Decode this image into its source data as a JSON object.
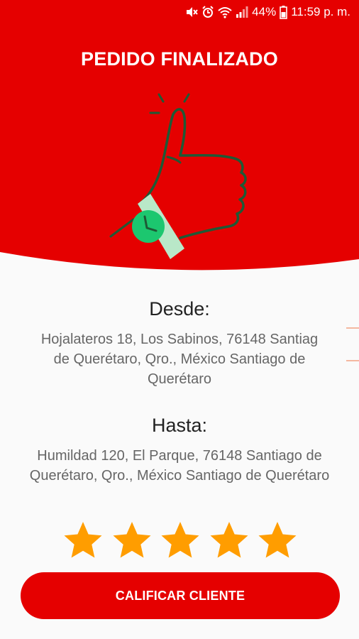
{
  "status_bar": {
    "battery": "44%",
    "time": "11:59 p. m."
  },
  "header": {
    "title": "PEDIDO FINALIZADO"
  },
  "origin": {
    "label": "Desde:",
    "address_lines": [
      "Hojalateros 18, Los Sabinos, 76148 Santiag",
      "de Querétaro, Qro., México Santiago de",
      "Querétaro"
    ]
  },
  "destination": {
    "label": "Hasta:",
    "address_lines": [
      "Humildad 120, El Parque, 76148 Santiago de",
      "Querétaro, Qro., México Santiago de Querétaro"
    ]
  },
  "rating": {
    "value": 5,
    "max": 5,
    "color": "#ff9d00"
  },
  "action": {
    "label": "CALIFICAR CLIENTE"
  },
  "colors": {
    "brand_red": "#e50000",
    "thumb_stroke": "#1e5a36",
    "watch_green": "#1cc76f",
    "strap_green": "#b9e8c8"
  }
}
